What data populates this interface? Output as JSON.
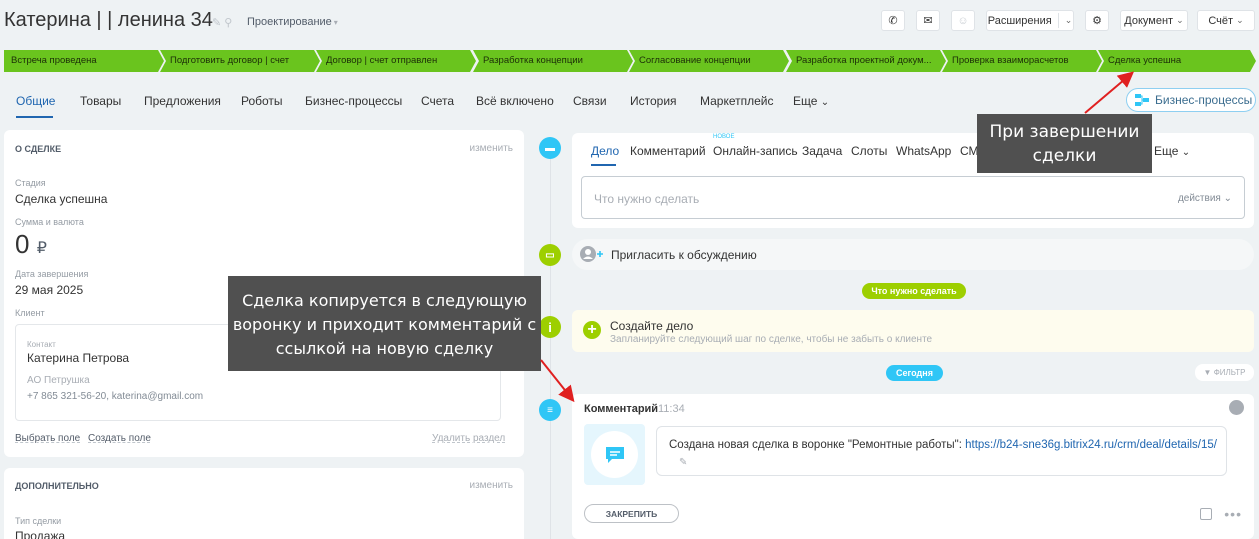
{
  "header": {
    "title": "Катерина | | ленина 34",
    "pipeline": "Проектирование",
    "extensions_label": "Расширения",
    "document_label": "Документ",
    "invoice_label": "Счёт"
  },
  "stages": [
    "Встреча проведена",
    "Подготовить договор | счет",
    "Договор | счет отправлен",
    "Разработка концепции",
    "Согласование концепции",
    "Разработка проектной докум...",
    "Проверка взаиморасчетов",
    "Сделка успешна"
  ],
  "tabs": [
    "Общие",
    "Товары",
    "Предложения",
    "Роботы",
    "Бизнес-процессы",
    "Счета",
    "Всё включено",
    "Связи",
    "История",
    "Маркетплейс",
    "Еще"
  ],
  "business_processes_button": "Бизнес-процессы",
  "about_card": {
    "title": "О сделке",
    "edit": "изменить",
    "stage_label": "Стадия",
    "stage_value": "Сделка успешна",
    "sum_label": "Сумма и валюта",
    "sum_value": "0",
    "currency": "₽",
    "close_date_label": "Дата завершения",
    "close_date_value": "29 мая 2025",
    "client_label": "Клиент",
    "contact_label": "Контакт",
    "contact_name": "Катерина Петрова",
    "company": "АО Петрушка",
    "contact_info": "+7 865 321-56-20, katerina@gmail.com",
    "select_field": "Выбрать поле",
    "create_field": "Создать поле",
    "delete_section": "Удалить раздел"
  },
  "extra_card": {
    "title": "Дополнительно",
    "edit": "изменить",
    "type_label": "Тип сделки",
    "type_value": "Продажа"
  },
  "editor": {
    "tabs": [
      "Дело",
      "Комментарий",
      "Онлайн-запись",
      "Задача",
      "Слоты",
      "WhatsApp",
      "СМ",
      "Еще"
    ],
    "new_badge": "НОВОЕ",
    "placeholder": "Что нужно сделать",
    "actions": "действия"
  },
  "invite_text": "Пригласить к обсуждению",
  "todo_pill": "Что нужно сделать",
  "todo": {
    "title": "Создайте дело",
    "subtitle": "Запланируйте следующий шаг по сделке, чтобы не забыть о клиенте"
  },
  "today_pill": "Сегодня",
  "filter_label": "ФИЛЬТР",
  "comment": {
    "title": "Комментарий",
    "time": "11:34",
    "text": "Создана новая сделка в воронке \"Ремонтные работы\": ",
    "link": "https://b24-sne36g.bitrix24.ru/crm/deal/details/15/",
    "pin": "ЗАКРЕПИТЬ"
  },
  "callouts": {
    "top": "При завершении сделки",
    "middle": "Сделка копируется в следующую воронку и приходит комментарий с ссылкой на новую сделку"
  },
  "colors": {
    "stage_green": "#6ac41e",
    "accent_blue": "#2066b0",
    "timeline_blue": "#2fc6f6",
    "timeline_green": "#9dcf00",
    "callout_bg": "#505050",
    "arrow_red": "#e02020"
  }
}
